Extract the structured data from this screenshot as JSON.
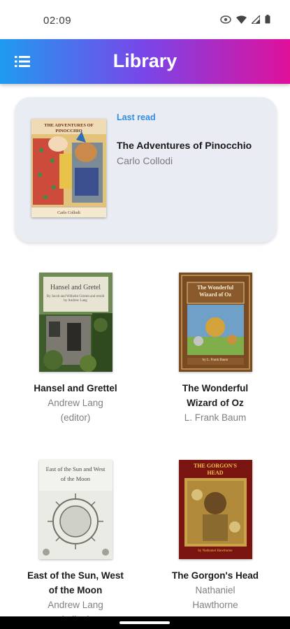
{
  "colors": {
    "gradient_start": "#1f9bf0",
    "gradient_mid": "#7a45e8",
    "gradient_end": "#e0109a",
    "accent": "#2f8de4"
  },
  "status": {
    "time": "02:09"
  },
  "app_bar": {
    "title": "Library",
    "menu_icon": "menu-list-icon"
  },
  "last_read": {
    "label": "Last read",
    "title": "The Adventures of Pinocchio",
    "author": "Carlo Collodi",
    "cover_title": "THE ADVENTURES OF PINOCCHIO",
    "cover_author": "Carlo Collodi"
  },
  "books": [
    {
      "title": "Hansel and Grettel",
      "author": "Andrew Lang (editor)",
      "cover_title": "Hansel and Gretel",
      "cover_sub": "By Jacob and Wilhelm Grimm and retold by Andrew Lang"
    },
    {
      "title": "The Wonderful Wizard of Oz",
      "author": "L. Frank Baum",
      "cover_title": "The Wonderful Wizard of Oz",
      "cover_sub": "by L. Frank Baum"
    },
    {
      "title": "East of the Sun, West of the Moon",
      "author": "Andrew Lang (editor)",
      "cover_title": "East of the Sun and West of the Moon"
    },
    {
      "title": "The Gorgon's Head",
      "author": "Nathaniel Hawthorne",
      "cover_title": "THE GORGON'S HEAD",
      "cover_sub": "by Nathaniel Hawthorne"
    }
  ]
}
